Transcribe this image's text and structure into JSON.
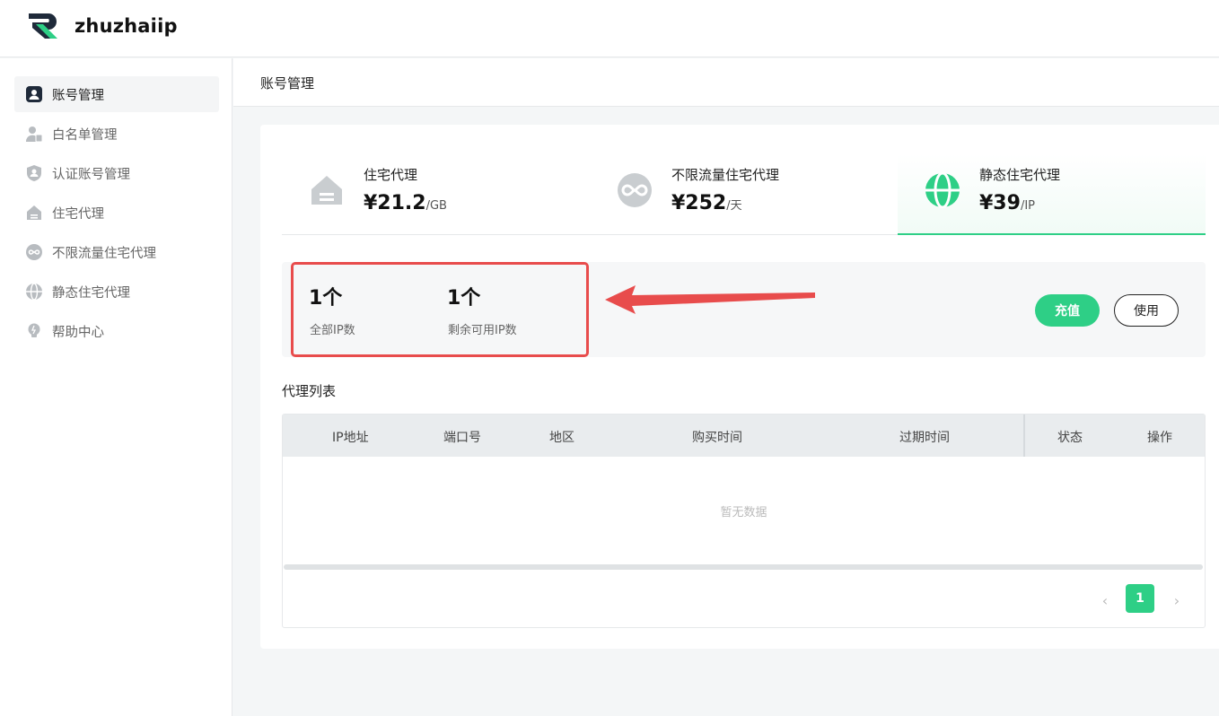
{
  "brand": {
    "name": "zhuzhaiip",
    "accent": "#2ecf86",
    "dark": "#1f2a3a"
  },
  "sidebar": {
    "items": [
      {
        "label": "账号管理",
        "icon": "user-icon",
        "active": true
      },
      {
        "label": "白名单管理",
        "icon": "whitelist-user-icon",
        "active": false
      },
      {
        "label": "认证账号管理",
        "icon": "shield-user-icon",
        "active": false
      },
      {
        "label": "住宅代理",
        "icon": "house-icon",
        "active": false
      },
      {
        "label": "不限流量住宅代理",
        "icon": "infinity-icon",
        "active": false
      },
      {
        "label": "静态住宅代理",
        "icon": "globe-icon",
        "active": false
      },
      {
        "label": "帮助中心",
        "icon": "lightbulb-icon",
        "active": false
      }
    ]
  },
  "page": {
    "title": "账号管理"
  },
  "product_tabs": [
    {
      "name": "住宅代理",
      "price": "¥21.2",
      "unit": "/GB",
      "icon": "house-icon",
      "active": false
    },
    {
      "name": "不限流量住宅代理",
      "price": "¥252",
      "unit": "/天",
      "icon": "infinity-icon",
      "active": false
    },
    {
      "name": "静态住宅代理",
      "price": "¥39",
      "unit": "/IP",
      "icon": "globe-icon",
      "active": true
    }
  ],
  "stats": {
    "total": {
      "value": "1个",
      "label": "全部IP数"
    },
    "remaining": {
      "value": "1个",
      "label": "剩余可用IP数"
    },
    "highlight_color": "#e84c4c"
  },
  "actions": {
    "recharge": "充值",
    "use": "使用"
  },
  "proxy_list": {
    "title": "代理列表",
    "columns": [
      "IP地址",
      "端口号",
      "地区",
      "购买时间",
      "过期时间",
      "状态",
      "操作"
    ],
    "rows": [],
    "empty_text": "暂无数据"
  },
  "pagination": {
    "current": "1",
    "prev_symbol": "‹",
    "next_symbol": "›"
  }
}
